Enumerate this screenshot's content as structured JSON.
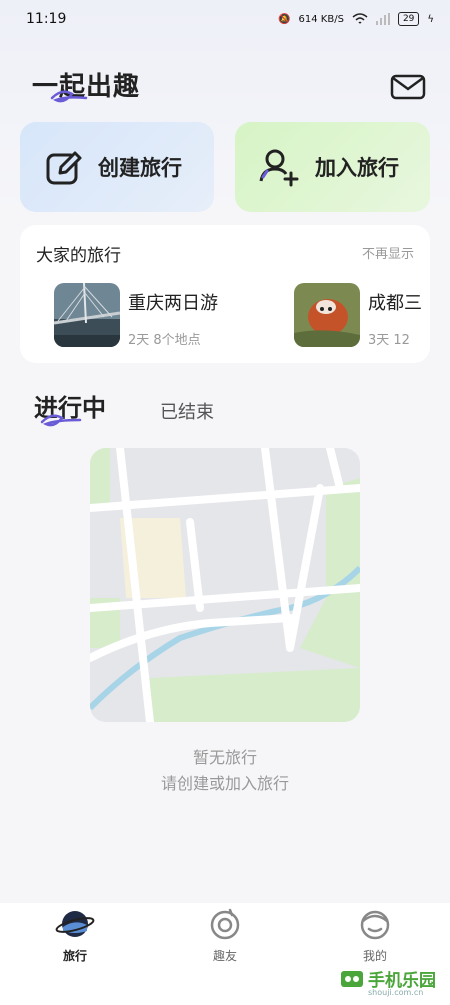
{
  "status_bar": {
    "time": "11:19",
    "network_speed": "614 KB/S",
    "battery": "29"
  },
  "header": {
    "title": "一起出趣"
  },
  "actions": {
    "create_label": "创建旅行",
    "join_label": "加入旅行"
  },
  "others_trips": {
    "title": "大家的旅行",
    "hide_label": "不再显示",
    "items": [
      {
        "name": "重庆两日游",
        "meta": "2天 8个地点"
      },
      {
        "name": "成都三",
        "meta": "3天 12"
      }
    ]
  },
  "tabs": {
    "active": "进行中",
    "inactive": "已结束"
  },
  "empty_state": {
    "line1": "暂无旅行",
    "line2": "请创建或加入旅行"
  },
  "bottom_nav": [
    {
      "label": "旅行"
    },
    {
      "label": "趣友"
    },
    {
      "label": "我的"
    }
  ],
  "watermark": {
    "text": "手机乐园",
    "sub": "shouji.com.cn"
  },
  "colors": {
    "accent_purple": "#6a5bd6",
    "green_card": "#d6f4c5",
    "blue_card": "#d7e6fa"
  }
}
